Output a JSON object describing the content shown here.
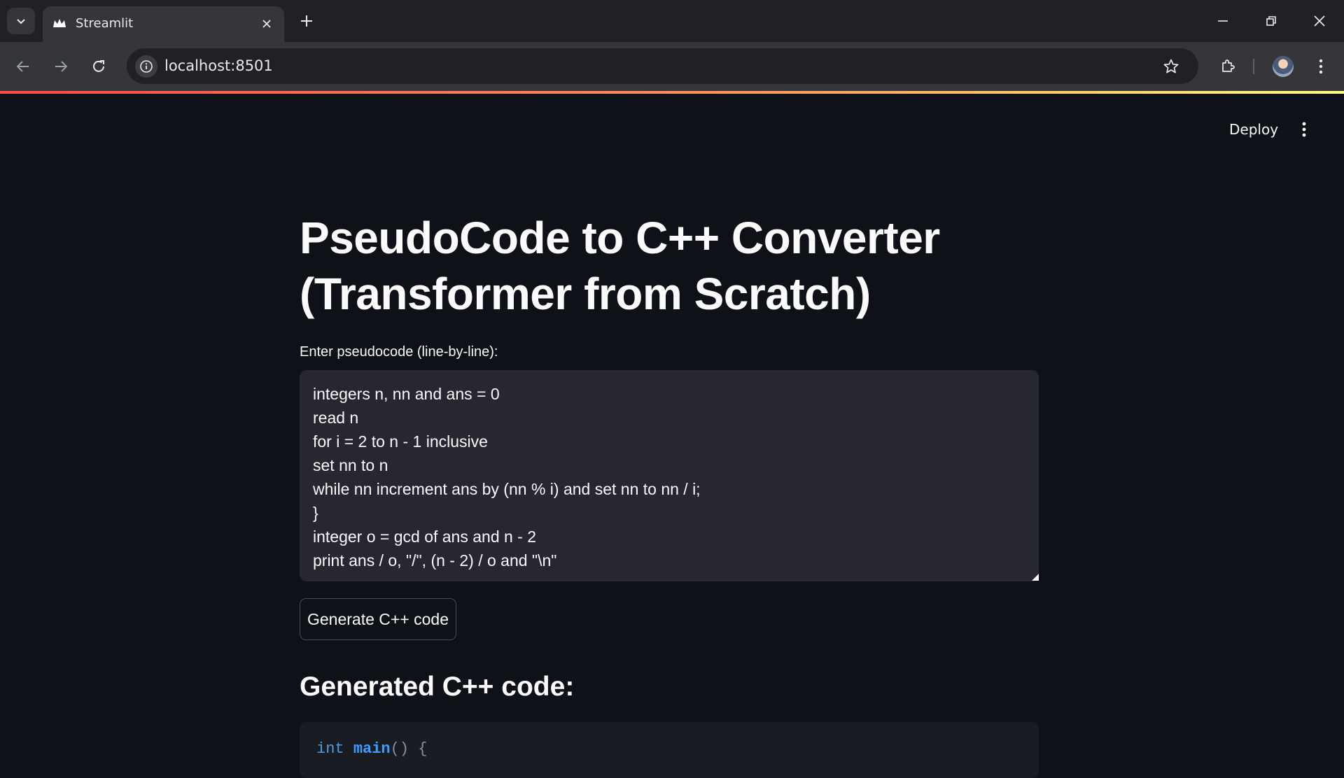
{
  "browser": {
    "tab_title": "Streamlit",
    "url": "localhost:8501"
  },
  "header": {
    "deploy_label": "Deploy"
  },
  "main": {
    "title_line1": "PseudoCode to C++ Converter",
    "title_line2": "(Transformer from Scratch)",
    "input_label": "Enter pseudocode (line-by-line):",
    "pseudocode": "integers n, nn and ans = 0\nread n\nfor i = 2 to n - 1 inclusive\nset nn to n\nwhile nn increment ans by (nn % i) and set nn to nn / i;\n}\ninteger o = gcd of ans and n - 2\nprint ans / o, \"/\", (n - 2) / o and \"\\n\"",
    "generate_button": "Generate C++ code",
    "output_heading": "Generated C++ code:",
    "code_first_line": {
      "keyword": "int",
      "function": "main",
      "rest": "() {"
    }
  },
  "colors": {
    "background": "#0e1117",
    "input_bg": "#262730",
    "accent_gradient_start": "#ff4b4b",
    "accent_gradient_end": "#fffd80"
  }
}
